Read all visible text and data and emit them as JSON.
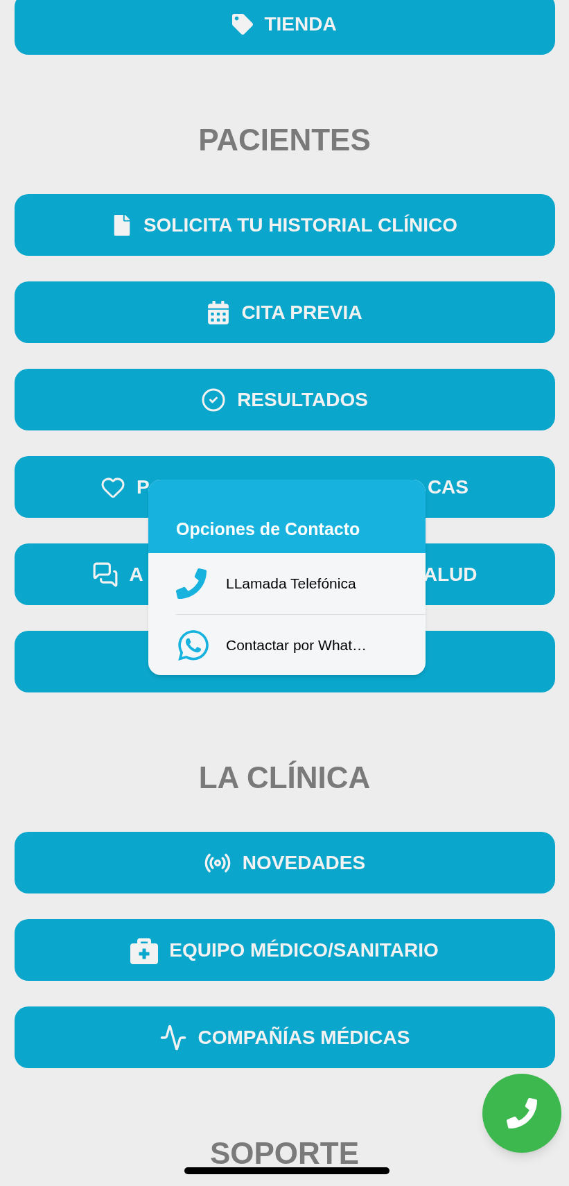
{
  "sections": [
    {
      "buttons": [
        {
          "kind": "full",
          "label": "TIENDA"
        }
      ]
    },
    {
      "heading": "PACIENTES",
      "buttons": [
        {
          "kind": "full",
          "label": "SOLICITA TU HISTORIAL CLÍNICO"
        },
        {
          "kind": "full",
          "label": "CITA PREVIA"
        },
        {
          "kind": "full",
          "label": "RESULTADOS"
        },
        {
          "kind": "covered",
          "label_start": "P",
          "label_end": "CAS"
        },
        {
          "kind": "covered",
          "label_start": "A",
          "label_end": "ALUD"
        },
        {
          "kind": "covered"
        }
      ]
    },
    {
      "heading": "LA CLÍNICA",
      "buttons": [
        {
          "kind": "full",
          "label": "NOVEDADES"
        },
        {
          "kind": "full",
          "label": "EQUIPO MÉDICO/SANITARIO"
        },
        {
          "kind": "full",
          "label": "COMPAÑÍAS MÉDICAS"
        }
      ]
    },
    {
      "heading": "SOPORTE"
    }
  ],
  "contact_popup": {
    "title": "Opciones de Contacto",
    "options": [
      {
        "kind": "phone",
        "label": "LLamada Telefónica"
      },
      {
        "kind": "whatsapp",
        "label": "Contactar por What…"
      }
    ]
  }
}
